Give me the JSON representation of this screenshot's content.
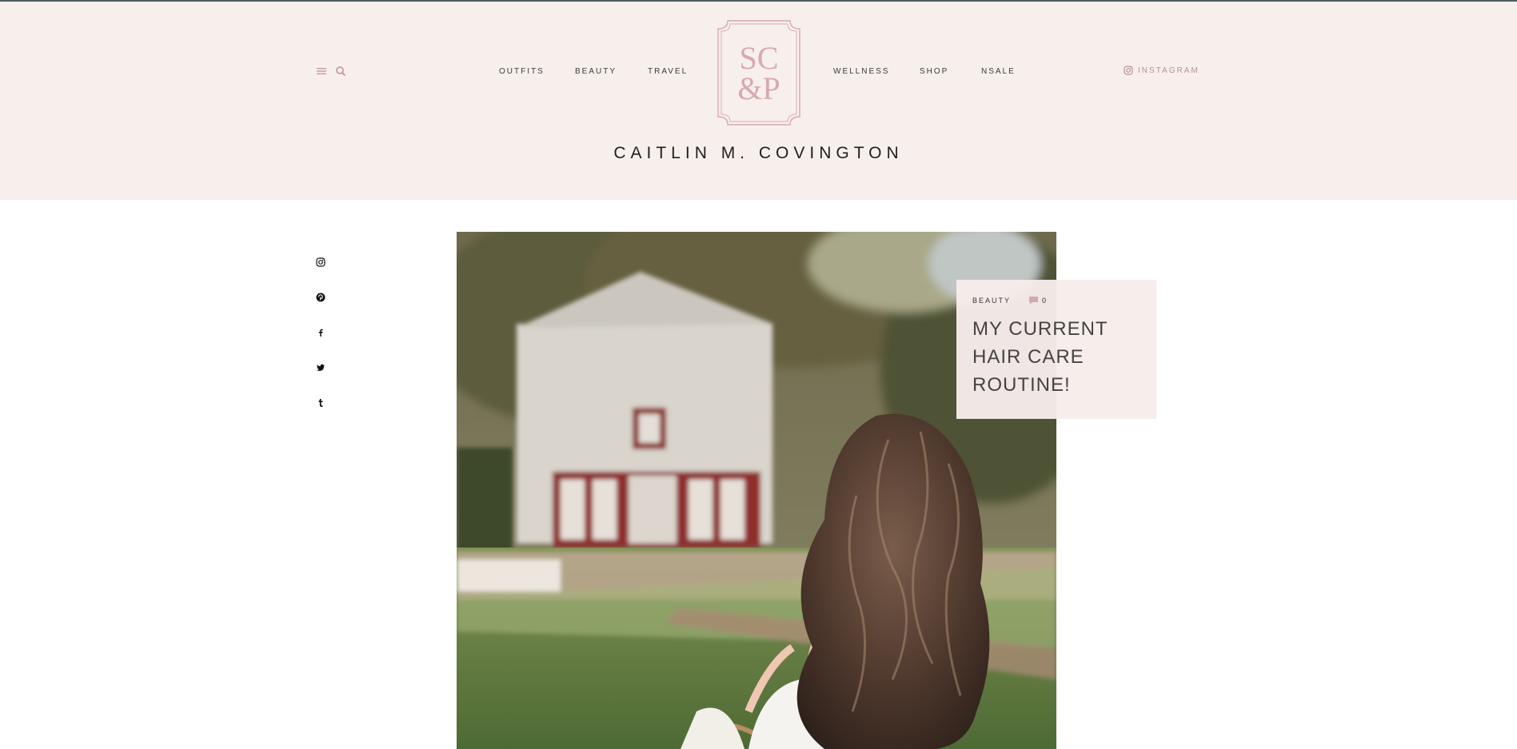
{
  "header": {
    "nav_left": [
      "OUTFITS",
      "BEAUTY",
      "TRAVEL"
    ],
    "nav_right": [
      "WELLNESS",
      "SHOP",
      "NSALE"
    ],
    "logo_text_top": "SC",
    "logo_text_bottom": "&P",
    "site_title": "CAITLIN M. COVINGTON",
    "instagram_label": "INSTAGRAM",
    "menu_icon": "hamburger-icon",
    "search_icon": "search-icon"
  },
  "social_rail": {
    "icons": [
      "instagram-icon",
      "pinterest-icon",
      "facebook-icon",
      "twitter-icon",
      "tumblr-icon"
    ]
  },
  "featured_post": {
    "category": "BEAUTY",
    "comment_count": "0",
    "title": "MY CURRENT HAIR CARE ROUTINE!"
  },
  "colors": {
    "header_bg": "#f7efeb",
    "accent_pink": "#d8a9ad",
    "card_bg": "#f7ecea"
  }
}
